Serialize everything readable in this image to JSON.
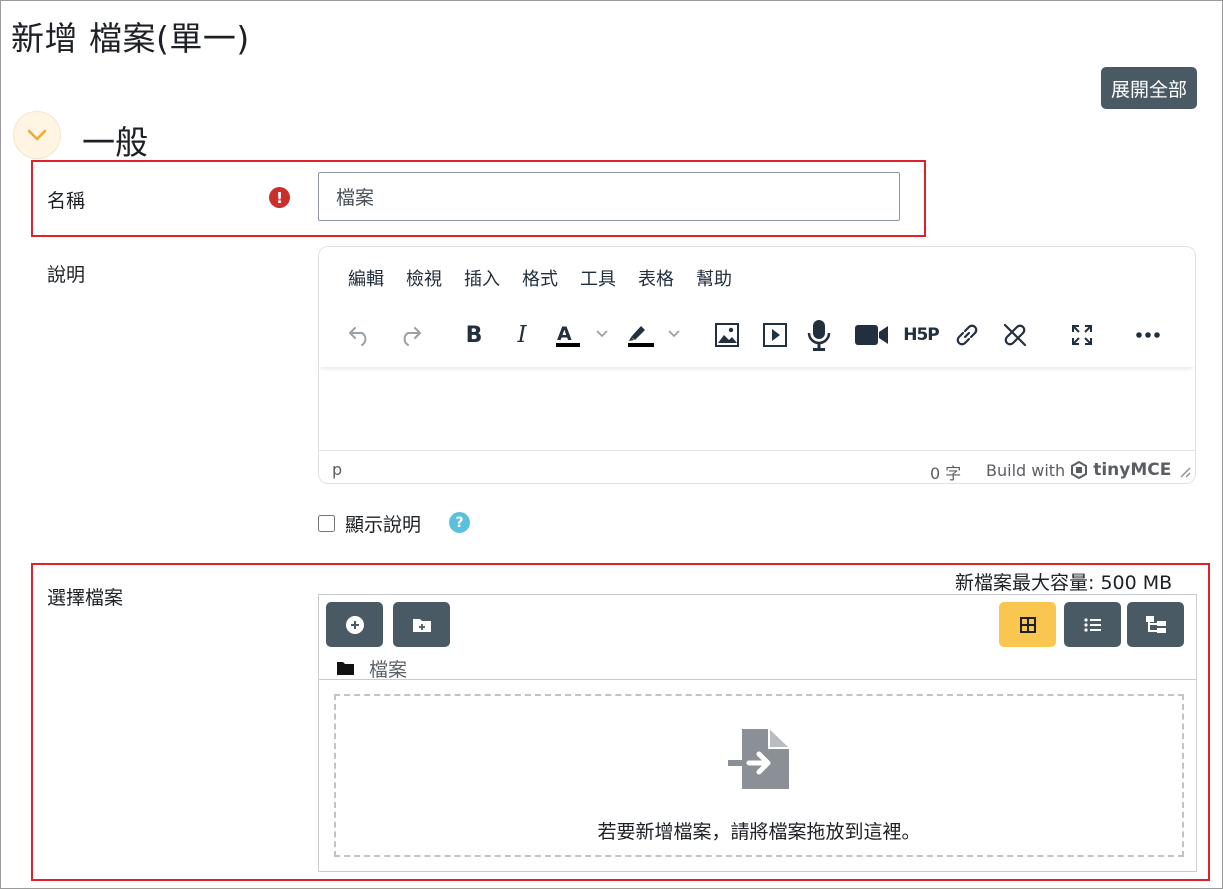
{
  "page_title": "新增 檔案(單一)",
  "expand_all_label": "展開全部",
  "section": {
    "title": "一般"
  },
  "name_field": {
    "label": "名稱",
    "value": "檔案",
    "required_icon": "exclamation-circle-icon"
  },
  "description_field": {
    "label": "說明",
    "menubar": [
      "編輯",
      "檢視",
      "插入",
      "格式",
      "工具",
      "表格",
      "幫助"
    ],
    "toolbar_icons": [
      "undo-icon",
      "redo-icon",
      "bold-icon",
      "italic-icon",
      "text-color-icon",
      "highlight-color-icon",
      "image-icon",
      "media-icon",
      "record-audio-icon",
      "record-video-icon",
      "h5p-icon",
      "link-icon",
      "unlink-icon",
      "fullscreen-icon",
      "more-icon"
    ],
    "bold_glyph": "B",
    "italic_glyph": "I",
    "text_color_glyph": "A",
    "h5p_glyph": "H5P",
    "status_path": "p",
    "word_count": "0 字",
    "build_with": "Build with",
    "brand": "tinyMCE"
  },
  "show_description": {
    "label": "顯示說明",
    "checked": false
  },
  "file_field": {
    "label": "選擇檔案",
    "max_size": "新檔案最大容量: 500 MB",
    "path_folder": "檔案",
    "drop_text": "若要新增檔案，請將檔案拖放到這裡。",
    "view_modes": [
      "grid-view-icon",
      "list-view-icon",
      "tree-view-icon"
    ],
    "active_view": "grid-view-icon"
  },
  "colors": {
    "primary_dark": "#4a5a64",
    "active_yellow": "#f9c74f",
    "highlight_red": "#e0212a",
    "required_red": "#c9302c",
    "help_blue": "#5bc0de"
  }
}
